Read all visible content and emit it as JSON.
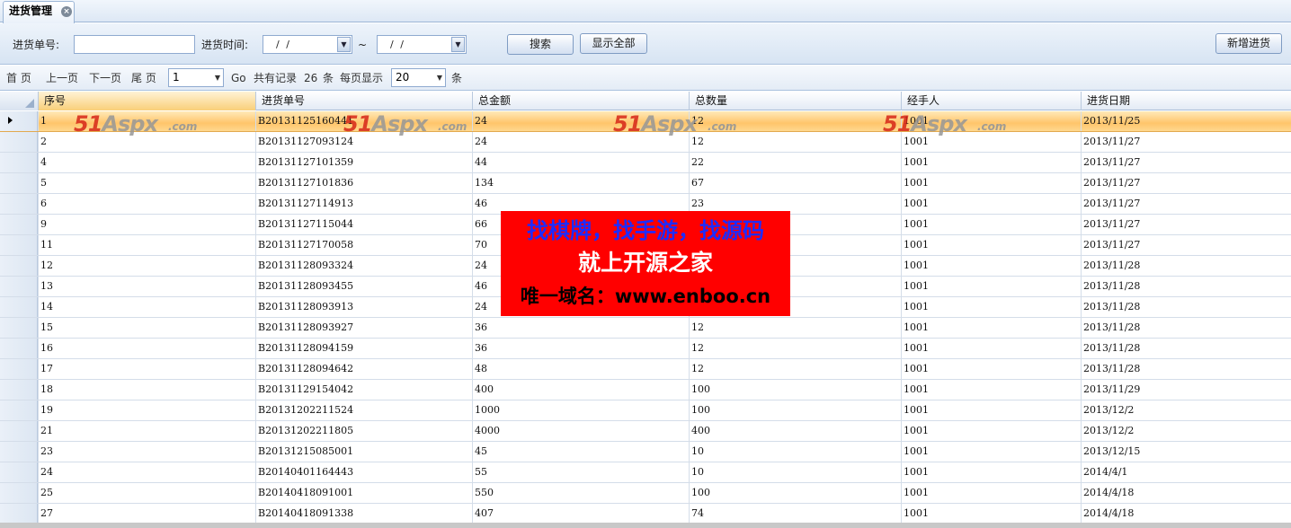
{
  "tab": {
    "title": "进货管理",
    "close": "×"
  },
  "search": {
    "order_no_label": "进货单号:",
    "order_no_value": "",
    "time_label": "进货时间:",
    "date_from": "/  /",
    "date_to": "/  /",
    "range_sep": "~",
    "search_button": "搜索",
    "show_all_button": "显示全部",
    "add_button": "新增进货"
  },
  "pager": {
    "first": "首 页",
    "prev": "上一页",
    "next": "下一页",
    "last": "尾 页",
    "page_value": "1",
    "go": "Go",
    "total_prefix": "共有记录",
    "total_count": "26",
    "total_suffix": "条",
    "per_page_label": "每页显示",
    "per_page_value": "20",
    "per_page_suffix": "条"
  },
  "grid": {
    "columns": [
      "序号",
      "进货单号",
      "总金额",
      "总数量",
      "经手人",
      "进货日期"
    ],
    "rows": [
      [
        "1",
        "B20131125160441",
        "24",
        "12",
        "1001",
        "2013/11/25"
      ],
      [
        "2",
        "B20131127093124",
        "24",
        "12",
        "1001",
        "2013/11/27"
      ],
      [
        "4",
        "B20131127101359",
        "44",
        "22",
        "1001",
        "2013/11/27"
      ],
      [
        "5",
        "B20131127101836",
        "134",
        "67",
        "1001",
        "2013/11/27"
      ],
      [
        "6",
        "B20131127114913",
        "46",
        "23",
        "1001",
        "2013/11/27"
      ],
      [
        "9",
        "B20131127115044",
        "66",
        "",
        "1001",
        "2013/11/27"
      ],
      [
        "11",
        "B20131127170058",
        "70",
        "",
        "1001",
        "2013/11/27"
      ],
      [
        "12",
        "B20131128093324",
        "24",
        "",
        "1001",
        "2013/11/28"
      ],
      [
        "13",
        "B20131128093455",
        "46",
        "",
        "1001",
        "2013/11/28"
      ],
      [
        "14",
        "B20131128093913",
        "24",
        "",
        "1001",
        "2013/11/28"
      ],
      [
        "15",
        "B20131128093927",
        "36",
        "12",
        "1001",
        "2013/11/28"
      ],
      [
        "16",
        "B20131128094159",
        "36",
        "12",
        "1001",
        "2013/11/28"
      ],
      [
        "17",
        "B20131128094642",
        "48",
        "12",
        "1001",
        "2013/11/28"
      ],
      [
        "18",
        "B20131129154042",
        "400",
        "100",
        "1001",
        "2013/11/29"
      ],
      [
        "19",
        "B20131202211524",
        "1000",
        "100",
        "1001",
        "2013/12/2"
      ],
      [
        "21",
        "B20131202211805",
        "4000",
        "400",
        "1001",
        "2013/12/2"
      ],
      [
        "23",
        "B20131215085001",
        "45",
        "10",
        "1001",
        "2013/12/15"
      ],
      [
        "24",
        "B20140401164443",
        "55",
        "10",
        "1001",
        "2014/4/1"
      ],
      [
        "25",
        "B20140418091001",
        "550",
        "100",
        "1001",
        "2014/4/18"
      ],
      [
        "27",
        "B20140418091338",
        "407",
        "74",
        "1001",
        "2014/4/18"
      ]
    ]
  },
  "watermark": {
    "brand": "51",
    "brand2": "Aspx",
    "domain": ".com"
  },
  "ad": {
    "line1": "找棋牌，找手游，找源码",
    "line2": "就上开源之家",
    "line3": "唯一域名：www.enboo.cn"
  }
}
